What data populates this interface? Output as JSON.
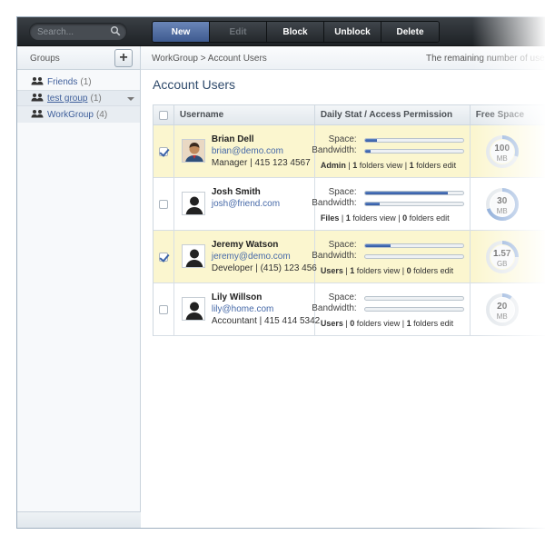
{
  "search": {
    "placeholder": "Search..."
  },
  "toolbar": {
    "new_label": "New",
    "edit_label": "Edit",
    "block_label": "Block",
    "unblock_label": "Unblock",
    "delete_label": "Delete"
  },
  "sidebar": {
    "title": "Groups",
    "add_label": "+",
    "groups": [
      {
        "name": "Friends",
        "count": "(1)"
      },
      {
        "name": "test group",
        "count": "(1)"
      },
      {
        "name": "WorkGroup",
        "count": "(4)"
      }
    ]
  },
  "main": {
    "breadcrumb": "WorkGroup > Account Users",
    "remaining": "The remaining number of users",
    "title": "Account Users",
    "columns": {
      "username": "Username",
      "stat": "Daily Stat / Access Permission",
      "free": "Free Space"
    },
    "labels": {
      "space": "Space:",
      "bandwidth": "Bandwidth:",
      "folders_view": "folders view",
      "folders_edit": "folders edit"
    },
    "users": [
      {
        "name": "Brian Dell",
        "email": "brian@demo.com",
        "role": "Manager | 415 123 4567",
        "checked": true,
        "space": 0.12,
        "bandwidth": 0.06,
        "perm_type": "Admin",
        "view": "1",
        "edit": "1",
        "free_value": "100",
        "free_unit": "MB",
        "free_ratio": 0.3
      },
      {
        "name": "Josh Smith",
        "email": "josh@friend.com",
        "role": "",
        "checked": false,
        "space": 0.84,
        "bandwidth": 0.15,
        "perm_type": "Files",
        "view": "1",
        "edit": "0",
        "free_value": "30",
        "free_unit": "MB",
        "free_ratio": 0.7
      },
      {
        "name": "Jeremy Watson",
        "email": "jeremy@demo.com",
        "role": "Developer | (415) 123 456",
        "checked": true,
        "space": 0.26,
        "bandwidth": 0.0,
        "perm_type": "Users",
        "view": "1",
        "edit": "0",
        "free_value": "1.57",
        "free_unit": "GB",
        "free_ratio": 0.25
      },
      {
        "name": "Lily Willson",
        "email": "lily@home.com",
        "role": "Accountant | 415 414 5342",
        "checked": false,
        "space": 0.0,
        "bandwidth": 0.0,
        "perm_type": "Users",
        "view": "0",
        "edit": "1",
        "free_value": "20",
        "free_unit": "MB",
        "free_ratio": 0.1
      }
    ]
  },
  "colors": {
    "accent": "#3f5f9b",
    "selected_row": "#fbf6cf",
    "bar_fill": "#2f56a2"
  }
}
